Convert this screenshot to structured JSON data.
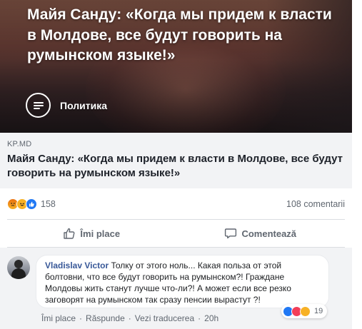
{
  "link_preview": {
    "image_headline": "Майя Санду: «Когда мы придем к власти в Молдове, все будут говорить на румынском языке!»",
    "category_label": "Политика",
    "source_domain": "KP.MD",
    "title": "Майя Санду: «Когда мы придем к власти в Молдове, все будут говорить на румынском языке!»"
  },
  "summary": {
    "reaction_icons": [
      "angry-icon",
      "haha-icon",
      "like-icon"
    ],
    "reaction_count": "158",
    "comment_count": "108 comentarii"
  },
  "actions": {
    "like_label": "Îmi place",
    "like_icon": "thumbs-up-icon",
    "comment_label": "Comentează",
    "comment_icon": "speech-bubble-icon"
  },
  "comment": {
    "author": "Vladislav Victor",
    "text": " Толку от этого ноль... Какая польза от этой болтовни, что все будут говорить на румынском?! Граждане Молдовы жить станут лучше что-ли?! А может если все резко заговорят на румынском так сразу пенсии вырастут ?!",
    "reaction_icons": [
      "like-icon",
      "love-icon",
      "haha-icon"
    ],
    "reaction_count": "19",
    "like_link": "Îmi place",
    "reply_link": "Răspunde",
    "translate_link": "Vezi traducerea",
    "separator": "·",
    "time": "20h"
  },
  "colors": {
    "facebook_link_blue": "#385898",
    "like_blue": "#2078f4",
    "haha_yellow": "#f7b125",
    "love_red": "#f33e58",
    "muted_text": "#606770"
  }
}
